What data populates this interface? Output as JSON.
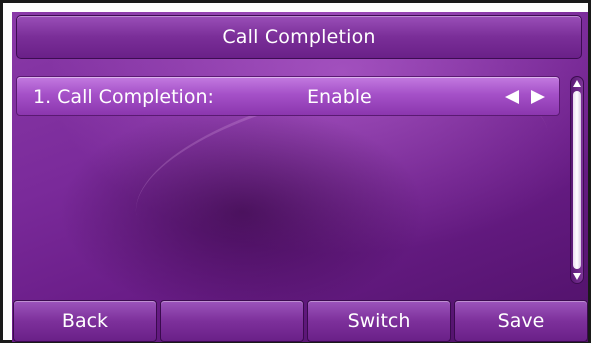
{
  "screen": {
    "title": "Call Completion",
    "settings": [
      {
        "label": "1. Call Completion:",
        "value": "Enable"
      }
    ]
  },
  "icons": {
    "row_left": "arrow-left-icon",
    "row_right": "arrow-right-icon",
    "scroll_up": "scroll-up-icon",
    "scroll_down": "scroll-down-icon"
  },
  "softkeys": {
    "key1": "Back",
    "key2": "",
    "key3": "Switch",
    "key4": "Save"
  },
  "colors": {
    "background": "#7a2a9a",
    "highlight_row": "#a551c8",
    "text": "#ffffff"
  }
}
